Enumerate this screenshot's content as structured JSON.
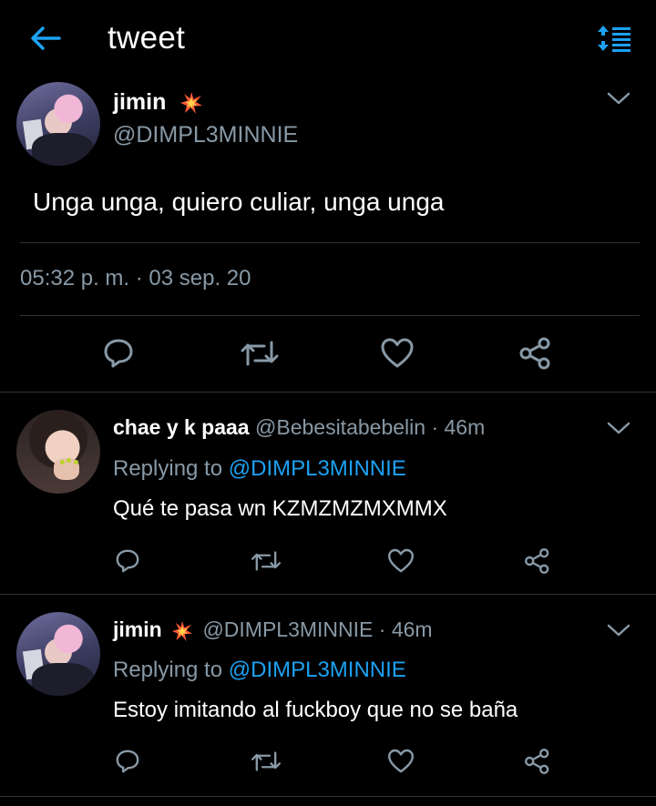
{
  "header": {
    "title": "tweet",
    "back_icon": "arrow-left-icon",
    "sort_icon": "sort-icon",
    "accent": "#1da1f2"
  },
  "main_tweet": {
    "name": "jimin",
    "name_emoji": "collision-icon",
    "handle": "@DIMPL3MINNIE",
    "text": "Unga unga, quiero culiar, unga unga",
    "timestamp": "05:32 p. m. · 03 sep. 20"
  },
  "replies": [
    {
      "name": "chae y k paaa",
      "handle": "@Bebesitabebelin",
      "time": "· 46m",
      "replying_prefix": "Replying to",
      "replying_to": "@DIMPL3MINNIE",
      "text": "Qué te pasa wn KZMZMZMXMMX"
    },
    {
      "name": "jimin",
      "name_emoji": "collision-icon",
      "handle": "@DIMPL3MINNIE",
      "time": "· 46m",
      "replying_prefix": "Replying to",
      "replying_to": "@DIMPL3MINNIE",
      "text": "Estoy imitando al fuckboy que no se baña"
    }
  ],
  "colors": {
    "background": "#000000",
    "secondary_text": "#8899a6",
    "link": "#1da1f2",
    "divider": "#2f3336",
    "icon": "#8899a6"
  }
}
